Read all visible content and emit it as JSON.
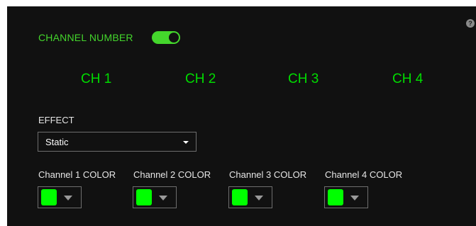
{
  "header": {
    "channel_number_label": "CHANNEL NUMBER",
    "channel_number_enabled": true,
    "help_symbol": "?"
  },
  "channel_tabs": [
    "CH 1",
    "CH 2",
    "CH 3",
    "CH 4"
  ],
  "effect": {
    "label": "EFFECT",
    "selected": "Static"
  },
  "channel_colors": [
    {
      "label": "Channel 1 COLOR",
      "color": "#00ff00"
    },
    {
      "label": "Channel 2 COLOR",
      "color": "#00ff00"
    },
    {
      "label": "Channel 3 COLOR",
      "color": "#00ff00"
    },
    {
      "label": "Channel 4 COLOR",
      "color": "#00ff00"
    }
  ],
  "theme": {
    "accent": "#44d62c",
    "tab_text": "#00dc00",
    "background": "#111111"
  },
  "icons": {
    "help": "question-circle-icon",
    "toggle": "toggle-switch-icon",
    "dropdown": "caret-down-icon"
  }
}
